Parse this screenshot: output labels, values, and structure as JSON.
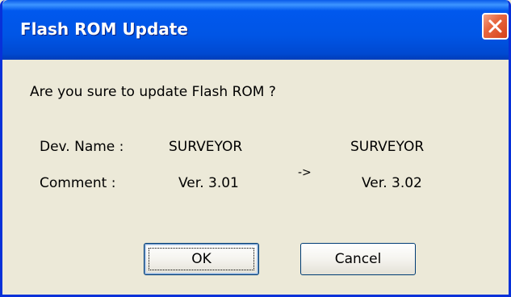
{
  "window": {
    "title": "Flash ROM Update"
  },
  "dialog": {
    "question": "Are you sure to update Flash ROM ?",
    "dev_name_label": "Dev. Name :",
    "comment_label": "Comment :",
    "current_name": "SURVEYOR",
    "current_version": "Ver. 3.01",
    "arrow": "->",
    "new_name": "SURVEYOR",
    "new_version": "Ver. 3.02"
  },
  "buttons": {
    "ok_label": "OK",
    "cancel_label": "Cancel"
  },
  "icons": {
    "close": "close-icon"
  },
  "colors": {
    "titlebar": "#0055E5",
    "close_button": "#E8673F",
    "background": "#ECE9D8",
    "window_border": "#0831D9"
  }
}
